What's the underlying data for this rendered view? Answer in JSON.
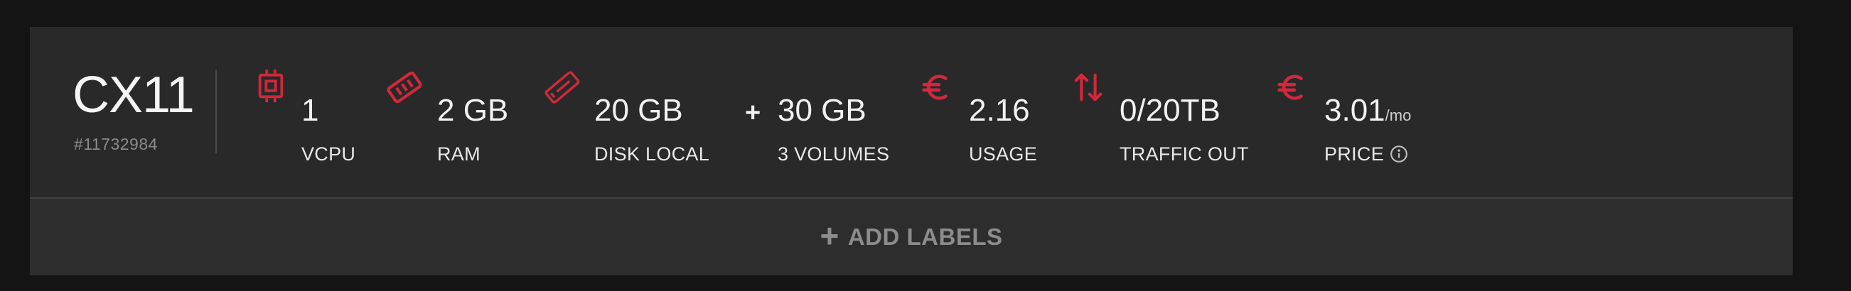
{
  "server": {
    "name": "CX11",
    "id": "#11732984"
  },
  "specs": {
    "vcpu": {
      "value": "1",
      "label": "VCPU",
      "icon": "cpu-icon"
    },
    "ram": {
      "value": "2 GB",
      "label": "RAM",
      "icon": "ram-icon"
    },
    "disk": {
      "value": "20 GB",
      "label": "DISK LOCAL",
      "icon": "disk-icon"
    },
    "volumes_separator": "+",
    "volumes": {
      "value": "30 GB",
      "label": "3 VOLUMES"
    },
    "usage": {
      "value": "2.16",
      "label": "USAGE",
      "icon": "euro-icon"
    },
    "traffic": {
      "value": "0/20TB",
      "label": "TRAFFIC OUT",
      "icon": "traffic-arrows-icon"
    },
    "price": {
      "value": "3.01",
      "unit": "/mo",
      "label": "PRICE",
      "icon": "euro-icon"
    }
  },
  "actions": {
    "add_labels_plus": "+",
    "add_labels": "ADD LABELS"
  },
  "colors": {
    "accent": "#d0293b",
    "background": "#141414",
    "card": "#292929",
    "muted_text": "#8c8c8c"
  }
}
